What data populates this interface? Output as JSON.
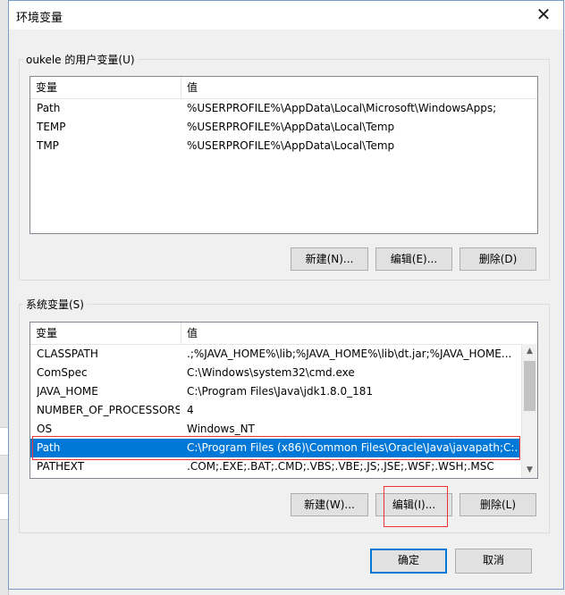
{
  "window": {
    "title": "环境变量",
    "close_glyph": "✕"
  },
  "user_vars": {
    "label": "oukele 的用户变量(U)",
    "col_name": "变量",
    "col_value": "值",
    "rows": [
      {
        "name": "Path",
        "value": "%USERPROFILE%\\AppData\\Local\\Microsoft\\WindowsApps;"
      },
      {
        "name": "TEMP",
        "value": "%USERPROFILE%\\AppData\\Local\\Temp"
      },
      {
        "name": "TMP",
        "value": "%USERPROFILE%\\AppData\\Local\\Temp"
      }
    ],
    "buttons": {
      "new": "新建(N)...",
      "edit": "编辑(E)...",
      "delete": "删除(D)"
    }
  },
  "system_vars": {
    "label": "系统变量(S)",
    "col_name": "变量",
    "col_value": "值",
    "rows": [
      {
        "name": "CLASSPATH",
        "value": ".;%JAVA_HOME%\\lib;%JAVA_HOME%\\lib\\dt.jar;%JAVA_HOME..."
      },
      {
        "name": "ComSpec",
        "value": "C:\\Windows\\system32\\cmd.exe"
      },
      {
        "name": "JAVA_HOME",
        "value": "C:\\Program Files\\Java\\jdk1.8.0_181"
      },
      {
        "name": "NUMBER_OF_PROCESSORS",
        "value": "4"
      },
      {
        "name": "OS",
        "value": "Windows_NT"
      },
      {
        "name": "Path",
        "value": "C:\\Program Files (x86)\\Common Files\\Oracle\\Java\\javapath;C:..."
      },
      {
        "name": "PATHEXT",
        "value": ".COM;.EXE;.BAT;.CMD;.VBS;.VBE;.JS;.JSE;.WSF;.WSH;.MSC"
      }
    ],
    "selected_index": 5,
    "buttons": {
      "new": "新建(W)...",
      "edit": "编辑(I)...",
      "delete": "删除(L)"
    }
  },
  "footer": {
    "ok": "确定",
    "cancel": "取消"
  },
  "colors": {
    "selection": "#0078d7",
    "annotation": "#e33333"
  }
}
